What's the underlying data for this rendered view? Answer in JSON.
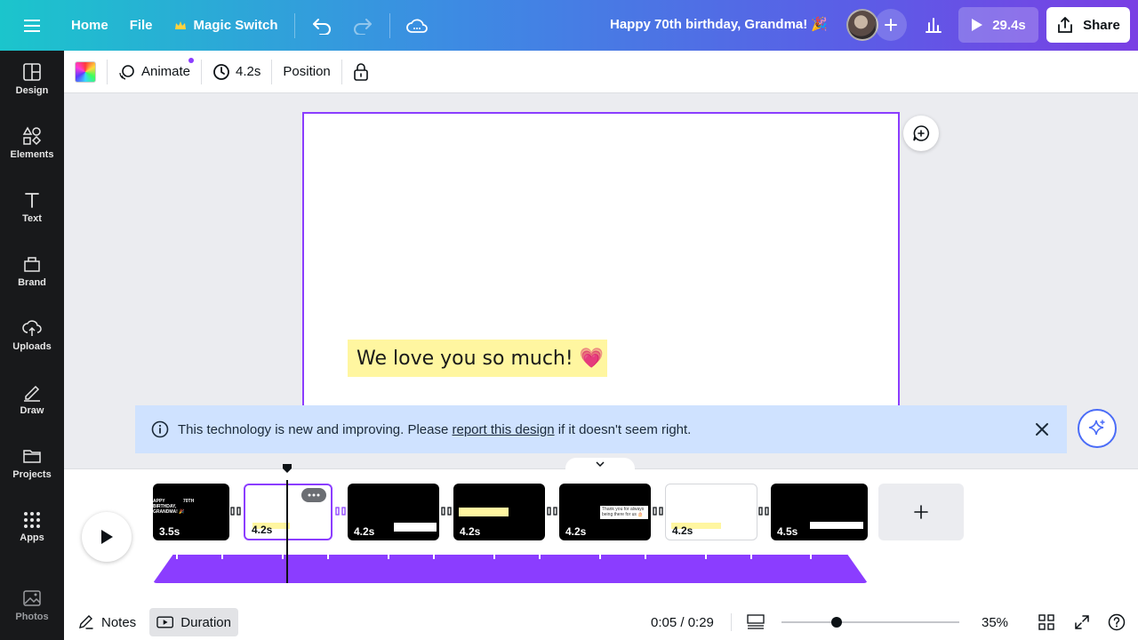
{
  "header": {
    "home": "Home",
    "file": "File",
    "magic_switch": "Magic Switch",
    "title": "Happy 70th birthday, Grandma! 🎉",
    "play_duration": "29.4s",
    "share": "Share"
  },
  "sidebar": {
    "items": [
      {
        "label": "Design"
      },
      {
        "label": "Elements"
      },
      {
        "label": "Text"
      },
      {
        "label": "Brand"
      },
      {
        "label": "Uploads"
      },
      {
        "label": "Draw"
      },
      {
        "label": "Projects"
      },
      {
        "label": "Apps"
      },
      {
        "label": "Photos"
      }
    ]
  },
  "toolbar": {
    "animate": "Animate",
    "duration": "4.2s",
    "position": "Position"
  },
  "canvas": {
    "text": "We love you so much! 💗"
  },
  "notice": {
    "before": "This technology is new and improving. Please ",
    "link": "report this design",
    "after": " if it doesn't seem right."
  },
  "timeline": {
    "pages": [
      {
        "duration": "3.5s",
        "style": "dark",
        "preview": "APPY BIRTHDAY, GRANDMA! 🎉  70TH"
      },
      {
        "duration": "4.2s",
        "style": "active",
        "preview": ""
      },
      {
        "duration": "4.2s",
        "style": "dark",
        "preview": ""
      },
      {
        "duration": "4.2s",
        "style": "dark",
        "preview": ""
      },
      {
        "duration": "4.2s",
        "style": "dark",
        "preview": "Thank you for always being there for us 🎂"
      },
      {
        "duration": "4.2s",
        "style": "light",
        "preview": ""
      },
      {
        "duration": "4.5s",
        "style": "dark",
        "preview": ""
      }
    ]
  },
  "bottom": {
    "notes": "Notes",
    "duration": "Duration",
    "time": "0:05 / 0:29",
    "zoom": "35%"
  }
}
